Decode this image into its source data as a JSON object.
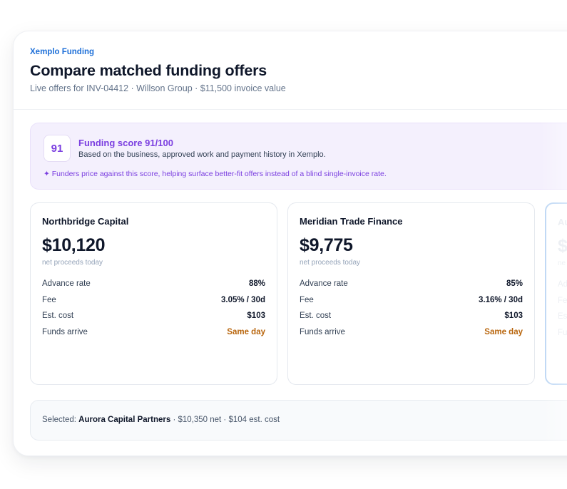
{
  "header": {
    "brand": "Xemplo Funding",
    "title": "Compare matched funding offers",
    "subtitle": "Live offers for INV-04412 · Willson Group · $11,500 invoice value"
  },
  "score": {
    "badge": "91",
    "title": "Funding score 91/100",
    "description": "Based on the business, approved work and payment history in Xemplo.",
    "note_icon": "sparkle-icon",
    "note": "✦ Funders price against this score, helping surface better-fit offers instead of a blind single-invoice rate."
  },
  "offers": [
    {
      "name": "Northbridge Capital",
      "amount": "$10,120",
      "amount_sub": "net proceeds today",
      "rows": [
        {
          "label": "Advance rate",
          "value": "88%"
        },
        {
          "label": "Fee",
          "value": "3.05% / 30d"
        },
        {
          "label": "Est. cost",
          "value": "$103"
        },
        {
          "label": "Funds arrive",
          "value": "Same day"
        }
      ]
    },
    {
      "name": "Meridian Trade Finance",
      "amount": "$9,775",
      "amount_sub": "net proceeds today",
      "rows": [
        {
          "label": "Advance rate",
          "value": "85%"
        },
        {
          "label": "Fee",
          "value": "3.16% / 30d"
        },
        {
          "label": "Est. cost",
          "value": "$103"
        },
        {
          "label": "Funds arrive",
          "value": "Same day"
        }
      ]
    },
    {
      "name": "Au",
      "amount": "$",
      "amount_sub": "ne",
      "rows": [
        {
          "label": "Ad"
        },
        {
          "label": "Fe"
        },
        {
          "label": "Es"
        },
        {
          "label": "Fu"
        }
      ]
    }
  ],
  "selected": {
    "prefix": "Selected: ",
    "name": "Aurora Capital Partners",
    "details": " · $10,350 net · $104 est. cost"
  },
  "colors": {
    "brand": "#1d6fd8",
    "score_accent": "#7b3fe0",
    "arrival_accent": "#b8650c",
    "selected_border": "#bcd6f4"
  }
}
